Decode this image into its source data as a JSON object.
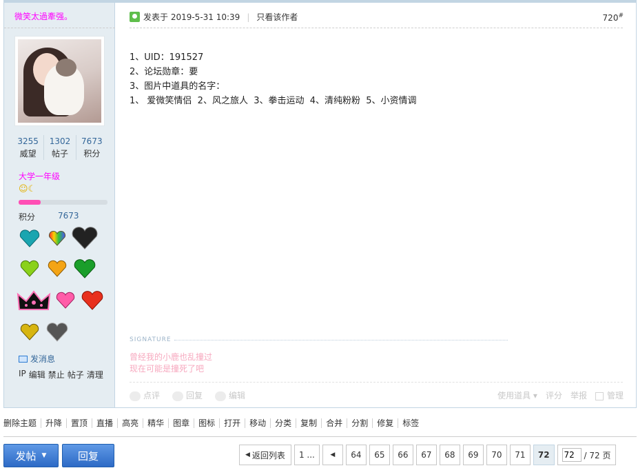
{
  "author": {
    "name": "微笑太過牽强。",
    "stats": [
      {
        "value": "3255",
        "label": "威望"
      },
      {
        "value": "1302",
        "label": "帖子"
      },
      {
        "value": "7673",
        "label": "积分"
      }
    ],
    "level": "大学一年级",
    "level_progress": 0.25,
    "credit_label": "积分",
    "credit_value": "7673",
    "pm_label": "发消息",
    "admin_links": [
      "IP",
      "编辑",
      "禁止",
      "帖子",
      "清理"
    ]
  },
  "post": {
    "posted_label": "发表于 2019-5-31 10:39",
    "only_author": "只看该作者",
    "floor": "720",
    "floor_sup": "#",
    "lines": [
      "1、UID：191527",
      "2、论坛勋章：要",
      "3、图片中道具的名字：",
      "1、 爱微笑情侣  2、风之旅人  3、拳击运动  4、清纯粉粉  5、小资情调"
    ],
    "signature_label": "SIGNATURE",
    "signature_lines": [
      "曾经我的小鹿也乱撞过",
      "现在可能是撞死了吧"
    ],
    "actions_left": [
      "点评",
      "回复",
      "编辑"
    ],
    "actions_right": [
      "使用道具",
      "评分",
      "举报",
      "管理"
    ]
  },
  "moderation": [
    "删除主题",
    "升降",
    "置顶",
    "直播",
    "高亮",
    "精华",
    "图章",
    "图标",
    "打开",
    "移动",
    "分类",
    "复制",
    "合并",
    "分割",
    "修复",
    "标签"
  ],
  "buttons": {
    "post": "发帖",
    "reply": "回复"
  },
  "pager": {
    "back": "返回列表",
    "first": "1 ...",
    "pages": [
      "64",
      "65",
      "66",
      "67",
      "68",
      "69",
      "70",
      "71"
    ],
    "current": "72",
    "input_value": "72",
    "total": "/ 72 页"
  },
  "colors": {
    "sidebar": "#e5edf2",
    "username": "#ff00ff",
    "link": "#336699",
    "button": "#2d6ac6"
  }
}
